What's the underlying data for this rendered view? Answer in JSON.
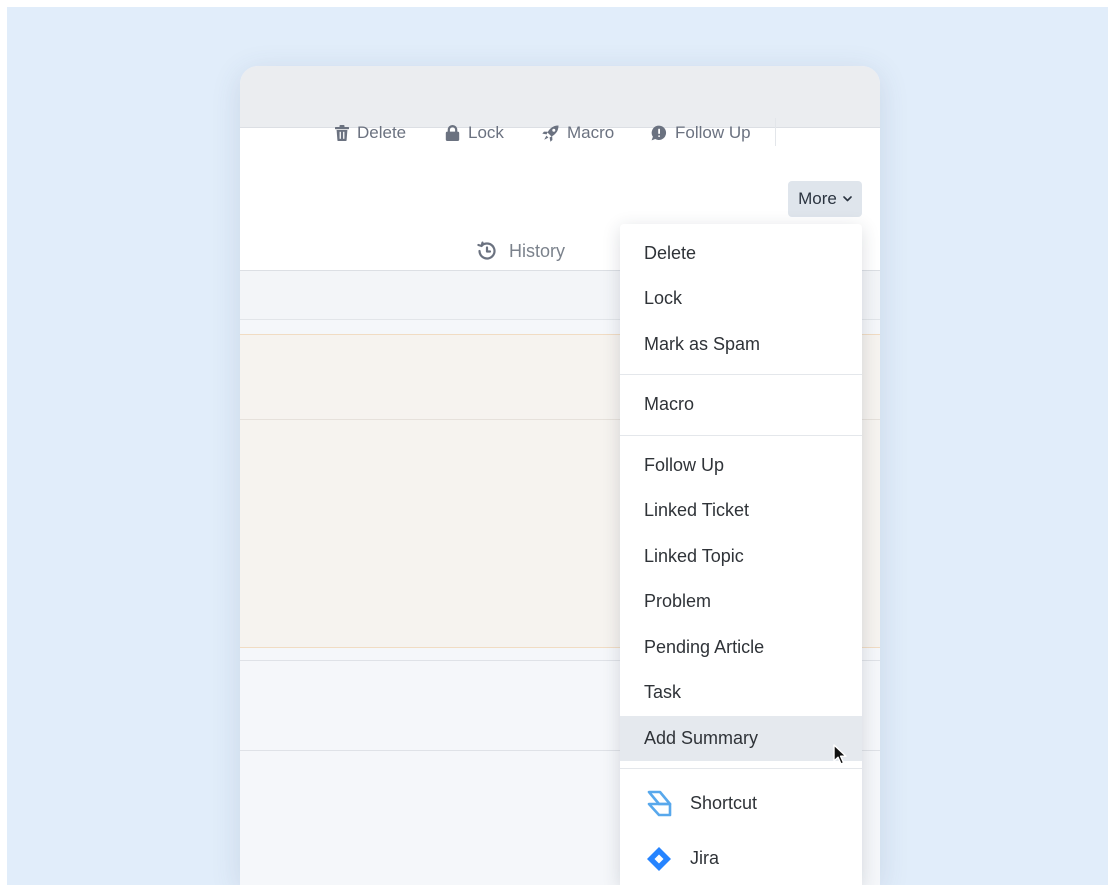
{
  "toolbar": {
    "delete_label": "Delete",
    "lock_label": "Lock",
    "macro_label": "Macro",
    "follow_up_label": "Follow Up",
    "more_label": "More"
  },
  "history": {
    "label": "History"
  },
  "menu": {
    "delete": "Delete",
    "lock": "Lock",
    "mark_as_spam": "Mark as Spam",
    "macro": "Macro",
    "follow_up": "Follow Up",
    "linked_ticket": "Linked Ticket",
    "linked_topic": "Linked Topic",
    "problem": "Problem",
    "pending_article": "Pending Article",
    "task": "Task",
    "add_summary": "Add Summary",
    "shortcut": "Shortcut",
    "jira": "Jira"
  },
  "icons": {
    "delete": "trash-icon",
    "lock": "lock-icon",
    "macro": "rocket-icon",
    "follow_up": "speech-bubble-icon",
    "more": "chevron-down-icon",
    "history": "history-icon",
    "shortcut": "shortcut-logo-icon",
    "jira": "jira-logo-icon"
  },
  "colors": {
    "backdrop": "#e1edfa",
    "more_button_bg": "#dfe5ec",
    "highlight_row": "#e5e9ee",
    "shortcut_brand": "#58a8ec",
    "jira_brand": "#2684ff"
  }
}
